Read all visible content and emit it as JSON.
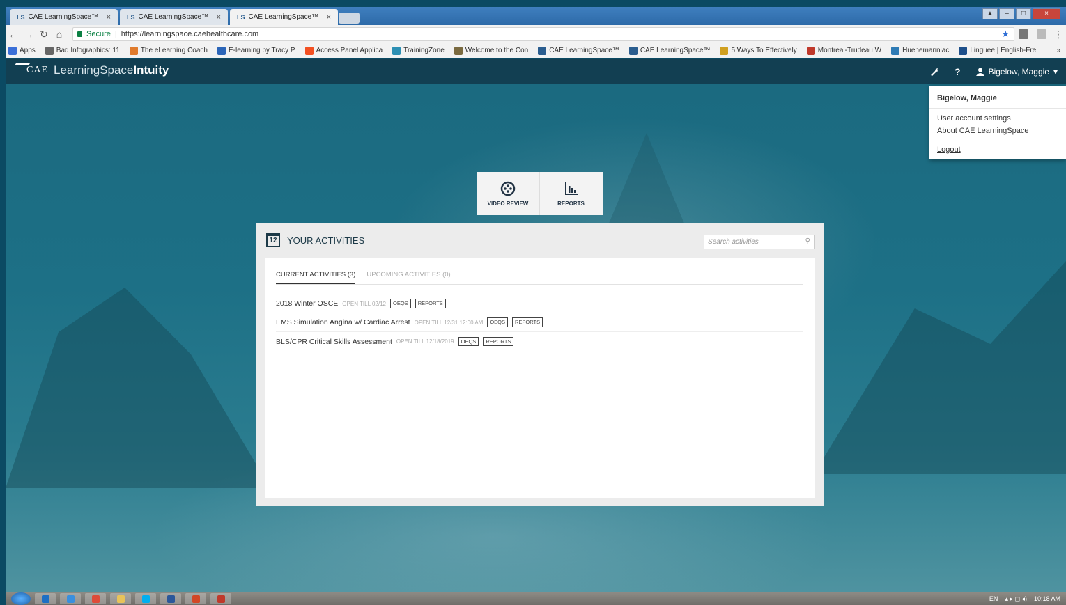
{
  "browser": {
    "tabs": [
      {
        "label": "CAE LearningSpace™",
        "favicon": "LS",
        "active": false
      },
      {
        "label": "CAE LearningSpace™",
        "favicon": "LS",
        "active": false
      },
      {
        "label": "CAE LearningSpace™",
        "favicon": "LS",
        "active": true
      }
    ],
    "tab_close": "×",
    "secure_label": "Secure",
    "url": "https://learningspace.caehealthcare.com",
    "bookmarks": [
      {
        "label": "Apps",
        "icon": "apps-grid-icon",
        "color": "#3b6fd8"
      },
      {
        "label": "Bad Infographics: 11",
        "icon": "bookmark-icon",
        "color": "#666666"
      },
      {
        "label": "The eLearning Coach",
        "icon": "bookmark-icon",
        "color": "#e07b2d"
      },
      {
        "label": "E-learning by Tracy P",
        "icon": "bookmark-icon",
        "color": "#2b65b8"
      },
      {
        "label": "Access Panel Applica",
        "icon": "bookmark-icon",
        "color": "#f25022"
      },
      {
        "label": "TrainingZone",
        "icon": "bookmark-icon",
        "color": "#2c8fb3"
      },
      {
        "label": "Welcome to the Con",
        "icon": "bookmark-icon",
        "color": "#7a6a40"
      },
      {
        "label": "CAE LearningSpace™",
        "icon": "bookmark-icon",
        "color": "#2a5d8f"
      },
      {
        "label": "CAE LearningSpace™",
        "icon": "bookmark-icon",
        "color": "#2a5d8f"
      },
      {
        "label": "5 Ways To Effectively",
        "icon": "bookmark-icon",
        "color": "#d0a020"
      },
      {
        "label": "Montreal-Trudeau W",
        "icon": "bookmark-icon",
        "color": "#c0392b"
      },
      {
        "label": "Huenemanniac",
        "icon": "bookmark-icon",
        "color": "#2e7bb5"
      },
      {
        "label": "Linguee | English-Fre",
        "icon": "bookmark-icon",
        "color": "#1d4f8a"
      }
    ],
    "bookmarks_more": "»"
  },
  "app": {
    "logo_cae": "CAE",
    "logo_name_light": "LearningSpace",
    "logo_name_bold": "Intuity",
    "help_label": "?",
    "user_name": "Bigelow, Maggie",
    "user_caret": "▾"
  },
  "user_menu": {
    "name": "Bigelow, Maggie",
    "items": [
      "User account settings",
      "About CAE LearningSpace"
    ],
    "logout": "Logout"
  },
  "tiles": [
    {
      "label": "VIDEO REVIEW",
      "icon": "film-reel-icon"
    },
    {
      "label": "REPORTS",
      "icon": "bar-chart-icon"
    }
  ],
  "activities": {
    "calendar_day": "12",
    "title": "YOUR ACTIVITIES",
    "search_placeholder": "Search activities",
    "tabs": [
      {
        "label": "CURRENT ACTIVITIES (3)",
        "active": true
      },
      {
        "label": "UPCOMING ACTIVITIES (0)",
        "active": false
      }
    ],
    "rows": [
      {
        "name": "2018 Winter OSCE",
        "open": "OPEN TILL 02/12",
        "actions": [
          "OEQS",
          "REPORTS"
        ]
      },
      {
        "name": "EMS Simulation Angina w/ Cardiac Arrest",
        "open": "OPEN TILL 12/31 12:00 AM",
        "actions": [
          "OEQS",
          "REPORTS"
        ]
      },
      {
        "name": "BLS/CPR Critical Skills Assessment",
        "open": "OPEN TILL 12/18/2019",
        "actions": [
          "OEQS",
          "REPORTS"
        ]
      }
    ]
  },
  "taskbar": {
    "apps": [
      {
        "icon": "outlook-icon",
        "color": "#1e6fc4"
      },
      {
        "icon": "internet-explorer-icon",
        "color": "#3a8fde"
      },
      {
        "icon": "chrome-icon",
        "color": "#dd4b39"
      },
      {
        "icon": "file-explorer-icon",
        "color": "#e8c35a"
      },
      {
        "icon": "skype-icon",
        "color": "#00aff0"
      },
      {
        "icon": "word-icon",
        "color": "#2b579a"
      },
      {
        "icon": "powerpoint-icon",
        "color": "#d24726"
      },
      {
        "icon": "snagit-icon",
        "color": "#c0392b"
      }
    ],
    "lang": "EN",
    "time": "10:18 AM"
  },
  "colors": {
    "appbar": "#123f52",
    "scene": "#1d7086",
    "panel": "#ececec"
  }
}
